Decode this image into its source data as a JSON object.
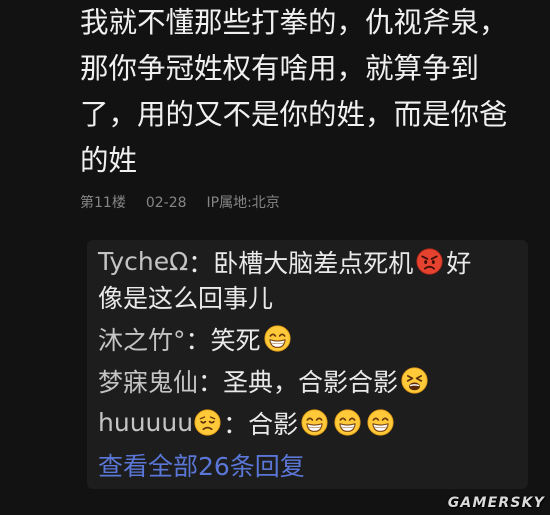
{
  "colors": {
    "background": "#121212",
    "reply_box": "#1d1d1d",
    "text_primary": "#f0f0f0",
    "text_secondary": "#858585",
    "username": "#c4c4c4",
    "link": "#5a76d6"
  },
  "comment": {
    "lines": [
      "我就不懂那些打拳的，仇视斧泉，",
      "那你争冠姓权有啥用，就算争到",
      "了，用的又不是你的姓，而是你爸",
      "的姓"
    ],
    "floor": "第11楼",
    "date": "02-28",
    "ip_location": "IP属地:北京"
  },
  "replies": [
    {
      "username": "TycheΩ",
      "separator": "：",
      "text": "卧槽大脑差点死机",
      "emoji": "angry-face-icon",
      "text_after": "好",
      "text_continued": "像是这么回事儿"
    },
    {
      "username": "沐之竹°",
      "separator": "：",
      "text": "笑死",
      "emojis": [
        "grin-face-icon"
      ]
    },
    {
      "username": "梦寐鬼仙",
      "separator": "：",
      "text": "圣典，合影合影",
      "emojis": [
        "tired-face-icon"
      ]
    },
    {
      "username": "huuuuu",
      "username_emoji": "disappointed-face-icon",
      "separator": "：",
      "text": "合影",
      "emojis": [
        "grin-face-icon",
        "grin-face-icon",
        "grin-face-icon"
      ]
    }
  ],
  "view_all_replies": "查看全部26条回复",
  "watermark": "GAMERSKY"
}
